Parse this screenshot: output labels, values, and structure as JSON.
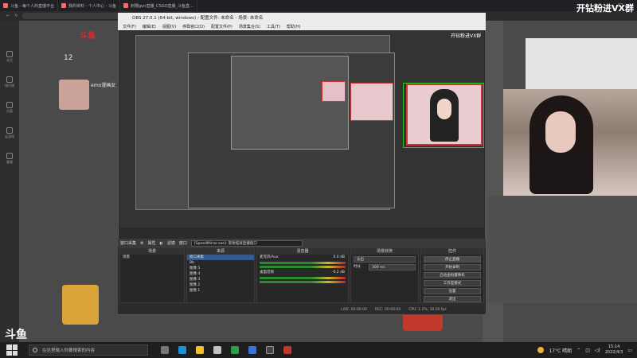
{
  "browser": {
    "tabs": [
      {
        "label": "斗鱼 - 每个人的直播平台"
      },
      {
        "label": "我的资料 - 个人中心 - 斗鱼"
      },
      {
        "label": "刺猬gun直播_CSGO直播_斗鱼直..."
      }
    ],
    "window_controls": [
      "—",
      "☐",
      "✕"
    ]
  },
  "overlay": {
    "top_right_text": "开钻粉进VX群",
    "obs_top_right_text": "开钻粉进VX群"
  },
  "site": {
    "logo": "斗鱼",
    "follow_count": "12",
    "streamer_name": "emo漫画女",
    "rail_items": [
      "关注",
      "排行榜",
      "分类",
      "云游戏",
      "客服"
    ]
  },
  "obs": {
    "title": "OBS 27.0.1 (64-bit, windows) - 配置文件: 未命名 - 场景: 未命名",
    "menu": [
      "文件(F)",
      "编辑(E)",
      "视图(V)",
      "停靠窗口(D)",
      "配置文件(P)",
      "场景集合(S)",
      "工具(T)",
      "帮助(H)"
    ],
    "source_bar": {
      "selected_label": "窗口采集",
      "props_label": "属性",
      "filter_label": "滤镜",
      "window_label": "窗口",
      "window_value": "[SpeedMirror.exe]: 影射拓屏直播窗口"
    },
    "docks": {
      "scenes": {
        "header": "场景",
        "items": [
          "场景"
        ]
      },
      "sources": {
        "header": "来源",
        "items": [
          "窗口采集",
          "Bb",
          "图像 5",
          "图像 4",
          "图像 3",
          "图像 2",
          "图像 1"
        ]
      },
      "mixer": {
        "header": "混音器",
        "channels": [
          {
            "name": "麦克风/Aux",
            "db": "0.0 dB"
          },
          {
            "name": "桌面音频",
            "db": "-0.2 dB"
          }
        ]
      },
      "transitions": {
        "header": "场景转换",
        "type": "淡出",
        "duration_label": "时长",
        "duration_value": "300 ms"
      },
      "controls": {
        "header": "控件",
        "buttons": [
          "停止直播",
          "开始录制",
          "启动虚拟摄像机",
          "工作室模式",
          "设置",
          "退出"
        ]
      }
    },
    "footer": {
      "live": "LIVE: 00:00:00",
      "rec": "REC: 00:00:00",
      "cpu": "CPU: 1.2%, 30.00 fps"
    }
  },
  "taskbar": {
    "search_placeholder": "在这里输入你要搜索的内容",
    "temperature": "17°C 晴朗",
    "time": "15:14",
    "date": "2022/4/3"
  }
}
